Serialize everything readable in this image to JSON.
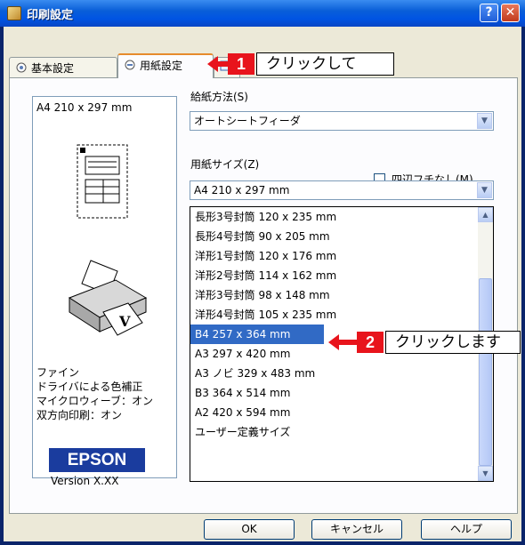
{
  "window": {
    "title": "印刷設定",
    "help_glyph": "?",
    "close_glyph": "✕"
  },
  "tabs": [
    {
      "label": "基本設定"
    },
    {
      "label": "用紙設定"
    }
  ],
  "info": {
    "paper_size": "A4 210 x 297 mm",
    "lines": [
      "ファイン",
      "ドライバによる色補正",
      "マイクロウィーブ：オン",
      "双方向印刷：オン"
    ],
    "brand": "EPSON",
    "version": "Version X.XX"
  },
  "form": {
    "feed_label": "給紙方法(S)",
    "feed_value": "オートシートフィーダ",
    "borderless_label": "四辺フチなし(M)",
    "size_label": "用紙サイズ(Z)",
    "size_value": "A4 210 x 297 mm"
  },
  "size_list": {
    "items": [
      "長形3号封筒 120 x 235 mm",
      "長形4号封筒 90 x 205 mm",
      "洋形1号封筒 120 x 176 mm",
      "洋形2号封筒 114 x 162 mm",
      "洋形3号封筒 98 x 148 mm",
      "洋形4号封筒 105 x 235 mm",
      "B4 257 x 364 mm",
      "A3 297 x 420 mm",
      "A3 ノビ 329 x 483 mm",
      "B3 364 x 514 mm",
      "A2 420 x 594 mm",
      "ユーザー定義サイズ"
    ],
    "selected_index": 6
  },
  "callouts": [
    {
      "number": "1",
      "text": "クリックして"
    },
    {
      "number": "2",
      "text": "クリックします"
    }
  ],
  "buttons": {
    "ok": "OK",
    "cancel": "キャンセル",
    "help": "ヘルプ"
  }
}
